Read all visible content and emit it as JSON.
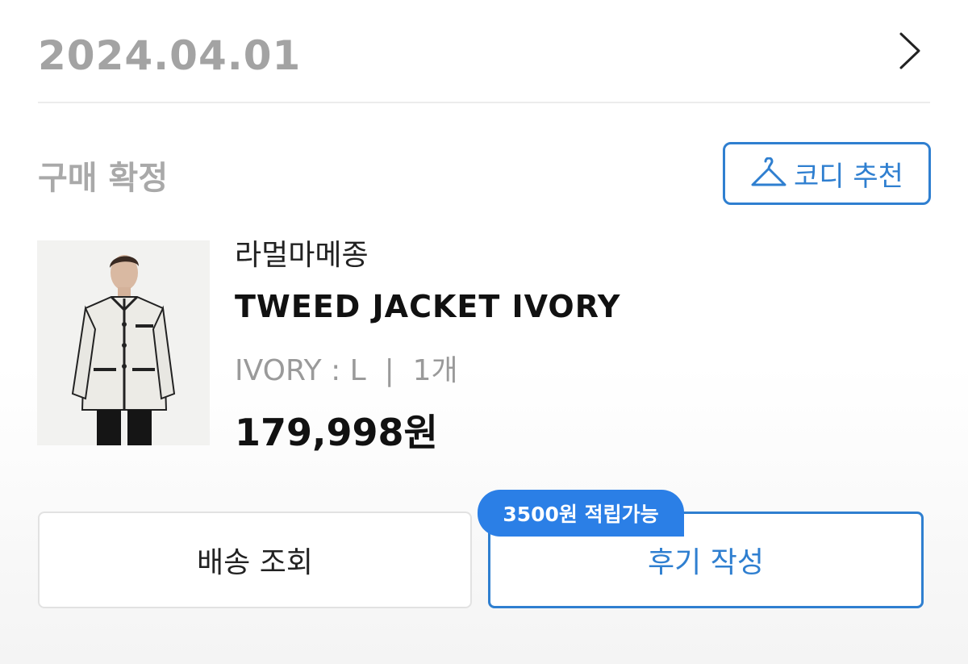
{
  "order": {
    "date": "2024.04.01",
    "status": "구매 확정"
  },
  "icons": {
    "detail": "chevron-right-icon",
    "coordi": "hanger-icon"
  },
  "coordi_button": {
    "label": "코디 추천"
  },
  "product": {
    "brand": "라멀마메종",
    "name": "TWEED JACKET IVORY",
    "option": "IVORY : L  |  1개",
    "price": "179,998원"
  },
  "actions": {
    "delivery_label": "배송 조회",
    "review_label": "후기 작성",
    "points_badge": "3500원 적립가능"
  },
  "colors": {
    "accent": "#2f7fd0",
    "badge": "#2b7fe6",
    "muted_text": "#a3a3a3"
  }
}
